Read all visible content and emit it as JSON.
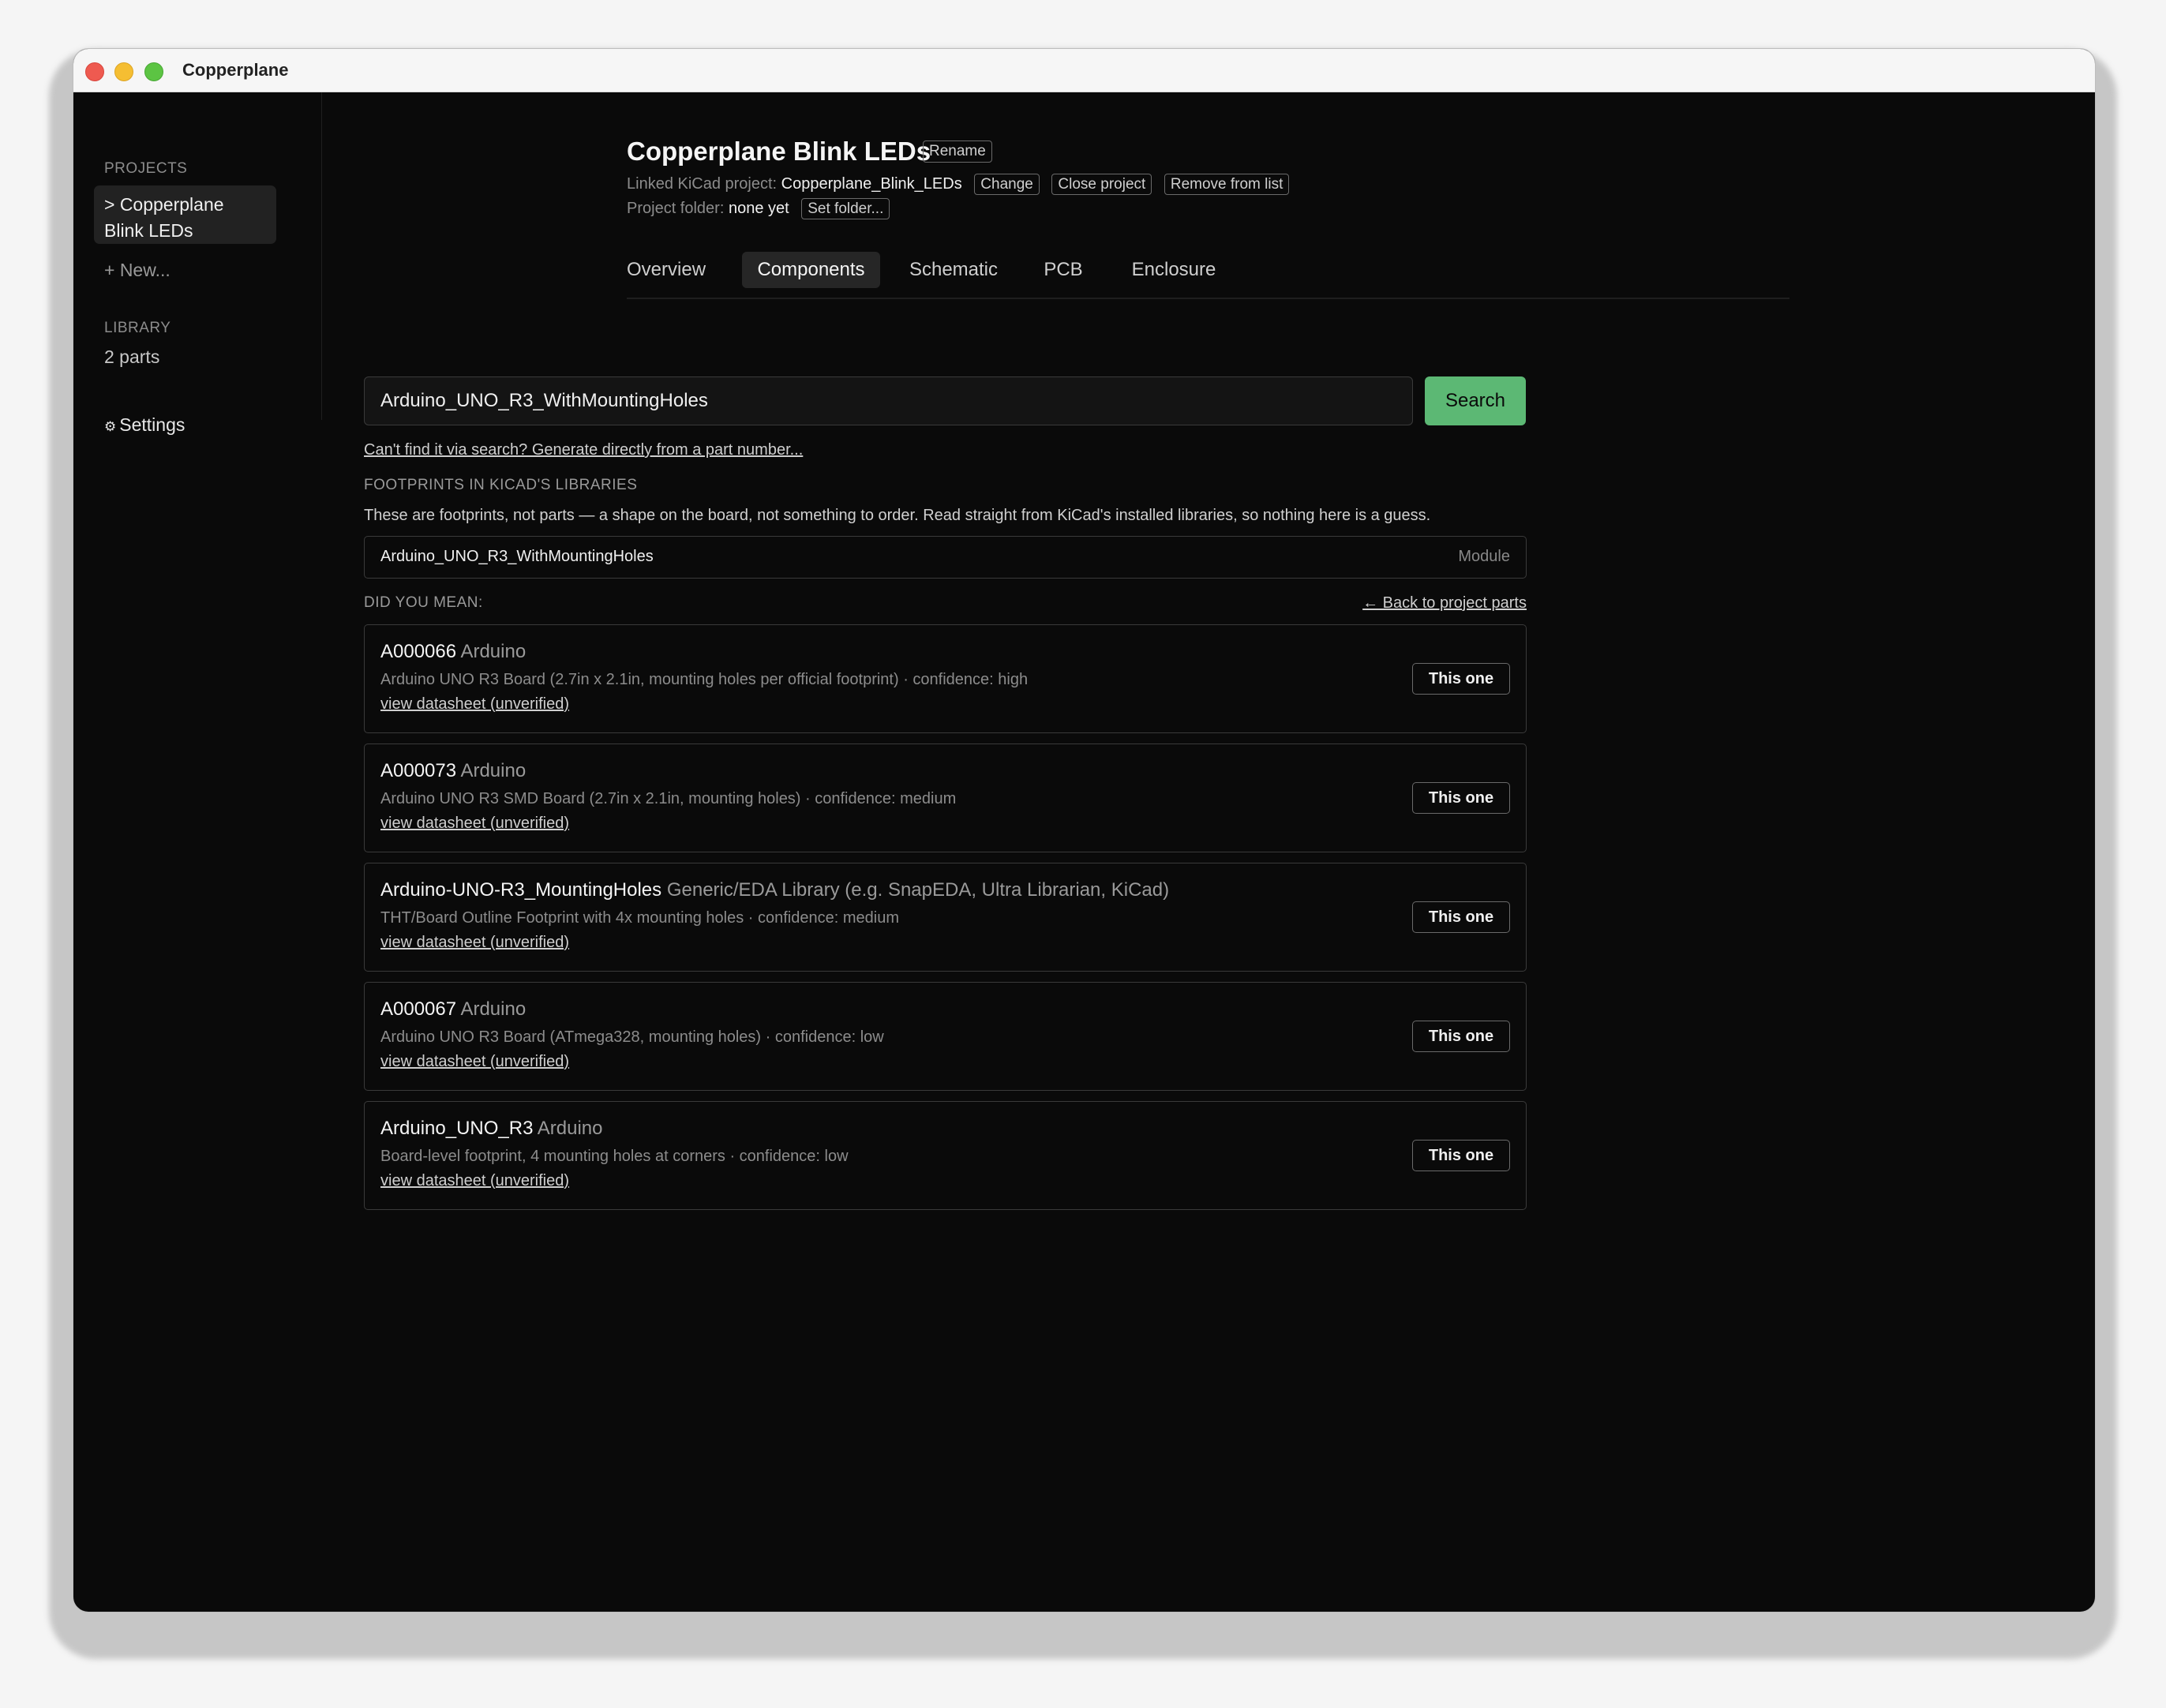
{
  "window": {
    "title": "Copperplane"
  },
  "sidebar": {
    "projects_heading": "PROJECTS",
    "active_project": "> Copperplane Blink LEDs",
    "new_label": "+ New...",
    "library_heading": "LIBRARY",
    "library_count": "2 parts",
    "settings_icon": "⚙",
    "settings_label": "Settings"
  },
  "project": {
    "title": "Copperplane Blink LEDs",
    "rename_label": "Rename",
    "linked_label": "Linked KiCad project:",
    "linked_value": "Copperplane_Blink_LEDs",
    "change_label": "Change",
    "close_label": "Close project",
    "remove_label": "Remove from list",
    "folder_label": "Project folder:",
    "folder_value": "none yet",
    "set_folder_label": "Set folder..."
  },
  "tabs": [
    {
      "label": "Overview",
      "active": false
    },
    {
      "label": "Components",
      "active": true
    },
    {
      "label": "Schematic",
      "active": false
    },
    {
      "label": "PCB",
      "active": false
    },
    {
      "label": "Enclosure",
      "active": false
    }
  ],
  "search": {
    "value": "Arduino_UNO_R3_WithMountingHoles",
    "button_label": "Search",
    "generate_link": "Can't find it via search? Generate directly from a part number..."
  },
  "footprints": {
    "heading": "FOOTPRINTS IN KICAD'S LIBRARIES",
    "description": "These are footprints, not parts — a shape on the board, not something to order. Read straight from KiCad's installed libraries, so nothing here is a guess.",
    "row": {
      "name": "Arduino_UNO_R3_WithMountingHoles",
      "kind": "Module"
    }
  },
  "suggestions": {
    "heading": "DID YOU MEAN:",
    "back_link": "← Back to project parts",
    "choose_label": "This one",
    "items": [
      {
        "part": "A000066",
        "manufacturer": "Arduino",
        "description": "Arduino UNO R3 Board (2.7in x 2.1in, mounting holes per official footprint) · confidence: high",
        "link": "view datasheet (unverified)"
      },
      {
        "part": "A000073",
        "manufacturer": "Arduino",
        "description": "Arduino UNO R3 SMD Board (2.7in x 2.1in, mounting holes) · confidence: medium",
        "link": "view datasheet (unverified)"
      },
      {
        "part": "Arduino-UNO-R3_MountingHoles",
        "manufacturer": "Generic/EDA Library (e.g. SnapEDA, Ultra Librarian, KiCad)",
        "description": "THT/Board Outline Footprint with 4x mounting holes · confidence: medium",
        "link": "view datasheet (unverified)"
      },
      {
        "part": "A000067",
        "manufacturer": "Arduino",
        "description": "Arduino UNO R3 Board (ATmega328, mounting holes) · confidence: low",
        "link": "view datasheet (unverified)"
      },
      {
        "part": "Arduino_UNO_R3",
        "manufacturer": "Arduino",
        "description": "Board-level footprint, 4 mounting holes at corners · confidence: low",
        "link": "view datasheet (unverified)"
      }
    ]
  },
  "colors": {
    "accent": "#5cb874",
    "background": "#0a0a0a"
  }
}
